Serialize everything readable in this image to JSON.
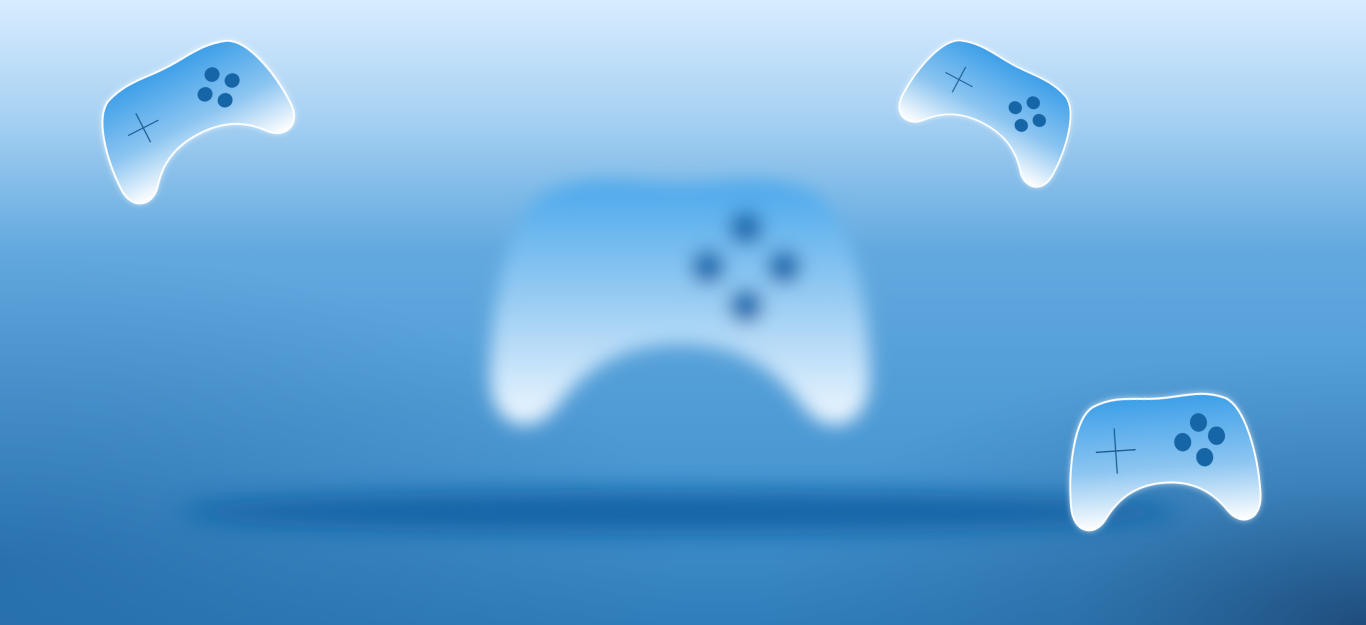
{
  "background": {
    "top_color": "#d6eaff",
    "mid_color": "#5aa2dc",
    "bottom_color": "#2f7cb8",
    "corner_shade": "#1e4f80"
  },
  "controllers": [
    {
      "name": "blurred-center-gamepad",
      "style": "blurred"
    },
    {
      "name": "gamepad-top-left",
      "style": "sharp"
    },
    {
      "name": "gamepad-top-right",
      "style": "sharp"
    },
    {
      "name": "gamepad-bottom-right",
      "style": "sharp"
    }
  ],
  "colors": {
    "controller_top": "#4aa8ec",
    "controller_bottom": "#ffffff",
    "buttons": "#1565a6",
    "dpad_line": "#1a5e93",
    "shadow_band": "#0a5ea3"
  }
}
